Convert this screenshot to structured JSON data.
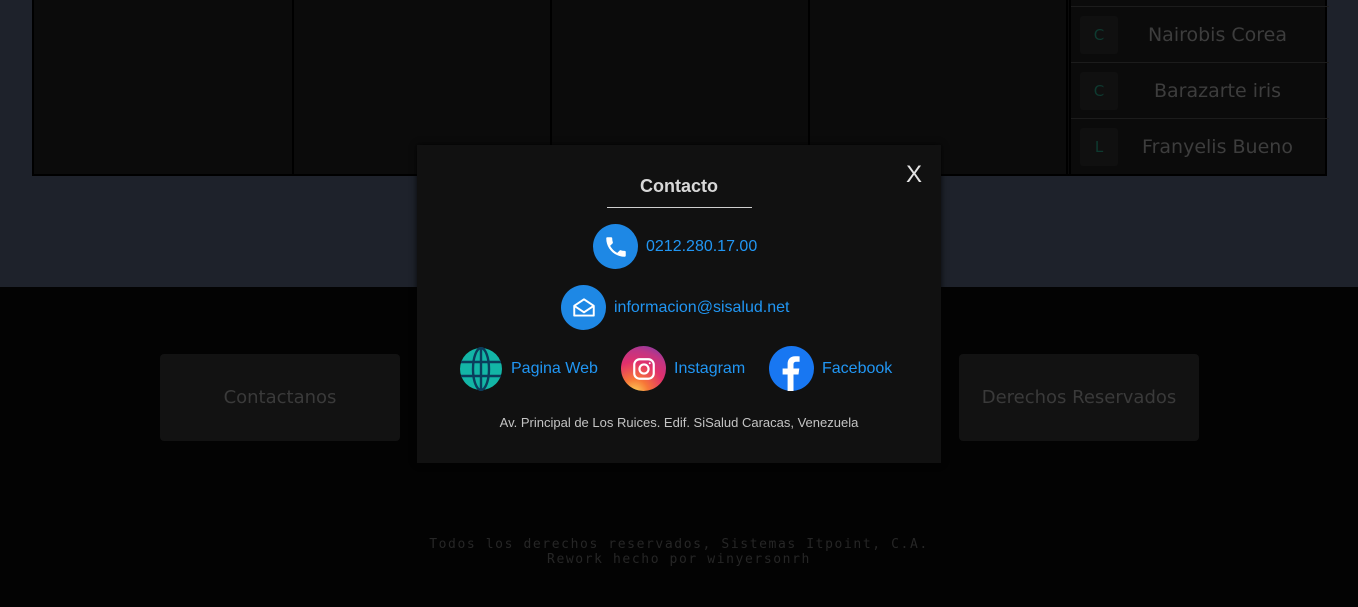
{
  "background_page": {
    "side_list": [
      {
        "badge": "C",
        "name": "Nairobis Corea"
      },
      {
        "badge": "C",
        "name": "Barazarte iris"
      },
      {
        "badge": "L",
        "name": "Franyelis Bueno"
      }
    ],
    "footer": {
      "left_card": "Contactanos",
      "right_card": "Derechos Reservados",
      "copyright_line1": "Todos los derechos reservados, Sistemas Itpoint, C.A.",
      "copyright_line2": "Rework hecho por winyersonrh"
    }
  },
  "modal": {
    "title": "Contacto",
    "close_label": "X",
    "phone": {
      "text": "0212.280.17.00",
      "icon": "phone-icon"
    },
    "email": {
      "text": "informacion@sisalud.net",
      "icon": "mail-icon"
    },
    "links": [
      {
        "text": "Pagina Web",
        "icon": "globe-icon"
      },
      {
        "text": "Instagram",
        "icon": "instagram-icon"
      },
      {
        "text": "Facebook",
        "icon": "facebook-icon"
      }
    ],
    "address": "Av. Principal de Los Ruices. Edif. SiSalud Caracas, Venezuela"
  },
  "colors": {
    "link": "#2196f3",
    "icon_blue": "#1e88e5",
    "modal_bg": "#111111"
  }
}
